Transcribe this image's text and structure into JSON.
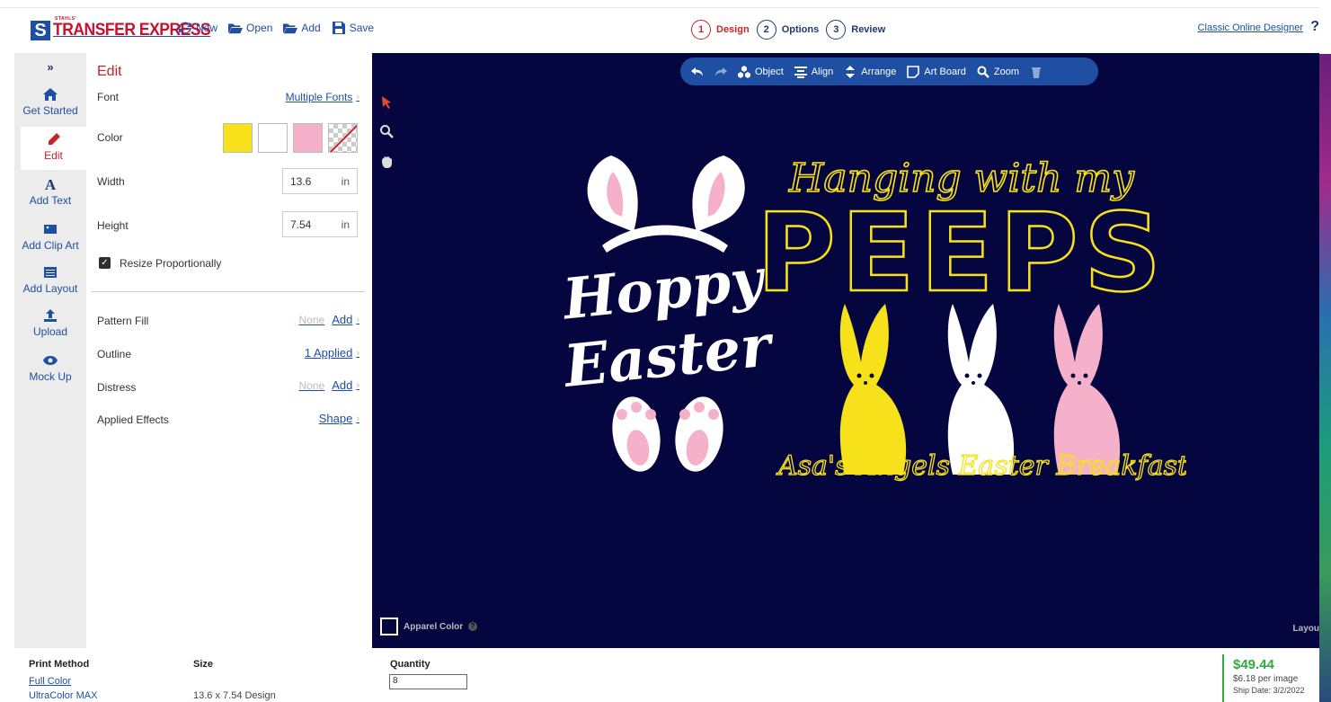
{
  "logo": {
    "mark": "S",
    "small": "STAHLS'",
    "main": "TRANSFER EXPRESS"
  },
  "toolbar": {
    "new": "New",
    "open": "Open",
    "add": "Add",
    "save": "Save"
  },
  "steps": [
    {
      "num": "1",
      "label": "Design"
    },
    {
      "num": "2",
      "label": "Options"
    },
    {
      "num": "3",
      "label": "Review"
    }
  ],
  "classic_link": "Classic Online Designer",
  "help": "?",
  "nav": {
    "expand": "»",
    "items": [
      "Get Started",
      "Edit",
      "Add Text",
      "Add Clip Art",
      "Add Layout",
      "Upload",
      "Mock Up"
    ]
  },
  "panel": {
    "title": "Edit",
    "font_label": "Font",
    "font_value": "Multiple Fonts",
    "color_label": "Color",
    "colors": [
      "#f7e11a",
      "#ffffff",
      "#f5b1c9"
    ],
    "width_label": "Width",
    "width_value": "13.6",
    "height_label": "Height",
    "height_value": "7.54",
    "unit": "in",
    "resize_label": "Resize Proportionally",
    "pattern_label": "Pattern Fill",
    "pattern_none": "None",
    "pattern_add": "Add",
    "outline_label": "Outline",
    "outline_value": "1 Applied",
    "distress_label": "Distress",
    "distress_none": "None",
    "distress_add": "Add",
    "effects_label": "Applied Effects",
    "effects_value": "Shape"
  },
  "canvas_toolbar": {
    "object": "Object",
    "align": "Align",
    "arrange": "Arrange",
    "artboard": "Art Board",
    "zoom": "Zoom"
  },
  "canvas": {
    "background": "#05063f",
    "apparel_label": "Apparel Color",
    "layout_label": "Layou",
    "design": {
      "line1": "Hanging with my",
      "line2": "PEEPS",
      "hoppy": "Hoppy",
      "easter": "Easter",
      "caption": "Asa's Angels Easter Breakfast",
      "yellow": "#f7e11a",
      "pink": "#f5b1c9"
    }
  },
  "footer": {
    "print_method_head": "Print Method",
    "print_method_link": "Full Color",
    "print_method_sub": "UltraColor MAX",
    "size_head": "Size",
    "size_value": "13.6 x 7.54 Design",
    "quantity_head": "Quantity",
    "quantity_value": "8",
    "price": "$49.44",
    "per_image": "$6.18 per image",
    "ship_date": "Ship Date: 3/2/2022"
  }
}
